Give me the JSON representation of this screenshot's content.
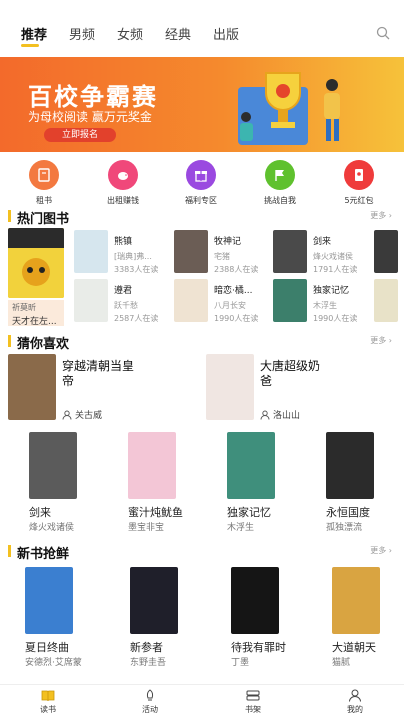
{
  "tabs": [
    "推荐",
    "男频",
    "女频",
    "经典",
    "出版"
  ],
  "banner": {
    "title": "百校争霸赛",
    "subtitle": "为母校阅读  赢万元奖金",
    "button": "立即报名"
  },
  "icons": [
    {
      "label": "租书",
      "color": "#f37940",
      "icon": "rent-book-icon"
    },
    {
      "label": "出租赚钱",
      "color": "#f0487a",
      "icon": "piggy-bank-icon"
    },
    {
      "label": "福利专区",
      "color": "#9a49e0",
      "icon": "gift-icon"
    },
    {
      "label": "挑战自我",
      "color": "#5fc12e",
      "icon": "flag-icon"
    },
    {
      "label": "5元红包",
      "color": "#ef3b3b",
      "icon": "red-packet-icon"
    }
  ],
  "hot": {
    "title": "热门图书",
    "more": "更多",
    "featured": {
      "author": "祈莫昕",
      "title": "天才在左..."
    },
    "books": [
      {
        "title": "熊镇",
        "sub1": "[瑞典]弗...",
        "sub2": "3383人在读"
      },
      {
        "title": "牧神记",
        "sub1": "宅猪",
        "sub2": "2388人在读"
      },
      {
        "title": "剑来",
        "sub1": "烽火戏诸侯",
        "sub2": "1791人在读"
      },
      {
        "title": "遵君",
        "sub1": "跃千愁",
        "sub2": "2587人在读"
      },
      {
        "title": "暗恋·橘...",
        "sub1": "八月长安",
        "sub2": "1990人在读"
      },
      {
        "title": "独家记忆",
        "sub1": "木浮生",
        "sub2": "1990人在读"
      }
    ]
  },
  "guess": {
    "title": "猜你喜欢",
    "more": "更多",
    "big": [
      {
        "title": "穿越清朝当皇帝",
        "author": "关古威"
      },
      {
        "title": "大唐超级奶爸",
        "author": "洛山山"
      }
    ],
    "books": [
      {
        "title": "剑来",
        "author": "烽火戏诸侯"
      },
      {
        "title": "蜜汁炖鱿鱼",
        "author": "墨宝非宝"
      },
      {
        "title": "独家记忆",
        "author": "木浮生"
      },
      {
        "title": "永恒国度",
        "author": "孤独漂流"
      }
    ]
  },
  "newbooks": {
    "title": "新书抢鲜",
    "more": "更多",
    "books": [
      {
        "title": "夏日终曲",
        "author": "安德烈·艾席蒙"
      },
      {
        "title": "新参者",
        "author": "东野圭吾"
      },
      {
        "title": "待我有罪时",
        "author": "丁墨"
      },
      {
        "title": "大道朝天",
        "author": "猫腻"
      }
    ]
  },
  "nav": [
    "读书",
    "活动",
    "书架",
    "我的"
  ]
}
